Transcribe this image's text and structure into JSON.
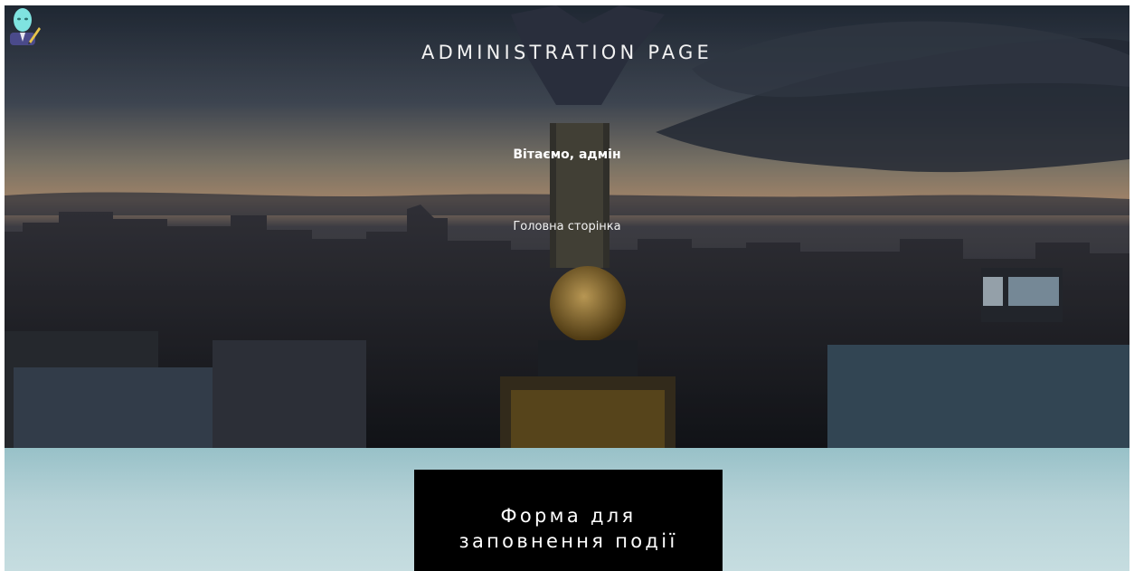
{
  "header": {
    "title": "ADMINISTRATION PAGE",
    "avatar_icon": "admin-avatar-icon",
    "welcome_text": "Вітаємо, адмін",
    "home_link_label": "Головна сторінка"
  },
  "main": {
    "form_button_label": "Форма для\nзаповнення події"
  },
  "colors": {
    "lower_background": "#b6d2d7",
    "button_background": "#000000",
    "button_text": "#ffffff"
  }
}
